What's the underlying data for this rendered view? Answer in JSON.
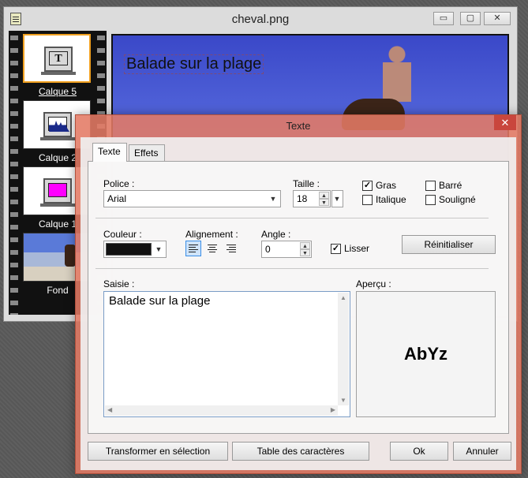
{
  "image_window": {
    "title": "cheval.png",
    "controls": {
      "minimize": "▭",
      "restore": "▢",
      "close": "✕"
    },
    "layers": [
      {
        "label": "Calque 5",
        "icon": "text-layer-icon",
        "glyph": "T",
        "selected": true
      },
      {
        "label": "Calque 2",
        "icon": "histogram-layer-icon",
        "selected": false
      },
      {
        "label": "Calque 1",
        "icon": "magenta-fill-layer-icon",
        "selected": false
      },
      {
        "label": "Fond",
        "icon": "photo-thumbnail",
        "selected": false
      }
    ],
    "canvas_text": "Balade sur la plage"
  },
  "dialog": {
    "title": "Texte",
    "close": "✕",
    "tabs": [
      {
        "label": "Texte",
        "active": true
      },
      {
        "label": "Effets",
        "active": false
      }
    ],
    "font": {
      "label": "Police :",
      "value": "Arial"
    },
    "size": {
      "label": "Taille :",
      "value": "18"
    },
    "styles": {
      "bold": {
        "label": "Gras",
        "checked": true
      },
      "italic": {
        "label": "Italique",
        "checked": false
      },
      "strike": {
        "label": "Barré",
        "checked": false
      },
      "underline": {
        "label": "Souligné",
        "checked": false
      }
    },
    "color": {
      "label": "Couleur :",
      "value": "#111111"
    },
    "alignment": {
      "label": "Alignement :",
      "selected": "left",
      "options": [
        "left",
        "center",
        "right"
      ]
    },
    "angle": {
      "label": "Angle :",
      "value": "0"
    },
    "smooth": {
      "label": "Lisser",
      "checked": true
    },
    "reset_label": "Réinitialiser",
    "input": {
      "label": "Saisie :",
      "value": "Balade sur la plage"
    },
    "preview": {
      "label": "Aperçu :",
      "sample": "AbYz"
    },
    "buttons": {
      "transform": "Transformer en sélection",
      "charmap": "Table des caractères",
      "ok": "Ok",
      "cancel": "Annuler"
    }
  }
}
